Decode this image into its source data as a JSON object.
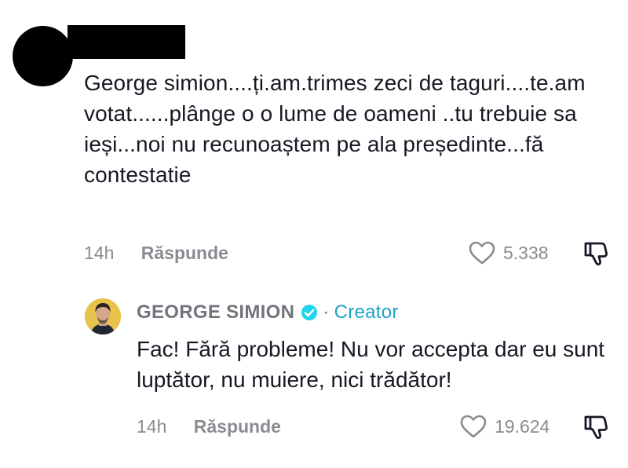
{
  "comment": {
    "text": "George simion....ți.am.trimes zeci de taguri....te.am votat......plânge o o lume de oameni ..tu trebuie sa ieși...noi nu recunoaștem pe ala președinte...fă contestatie",
    "time": "14h",
    "reply_label": "Răspunde",
    "likes": "5.338"
  },
  "reply": {
    "author": "GEORGE SIMION",
    "separator": "·",
    "badge": "Creator",
    "text": "Fac! Fără probleme! Nu vor accepta dar eu sunt luptător, nu muiere, nici trădător!",
    "time": "14h",
    "reply_label": "Răspunde",
    "likes": "19.624"
  },
  "colors": {
    "accent": "#1fa1c4",
    "muted": "#8a8b91",
    "text": "#161823"
  },
  "icons": {
    "like": "heart-outline-icon",
    "dislike": "thumbs-down-icon",
    "verified": "verified-check-icon"
  }
}
